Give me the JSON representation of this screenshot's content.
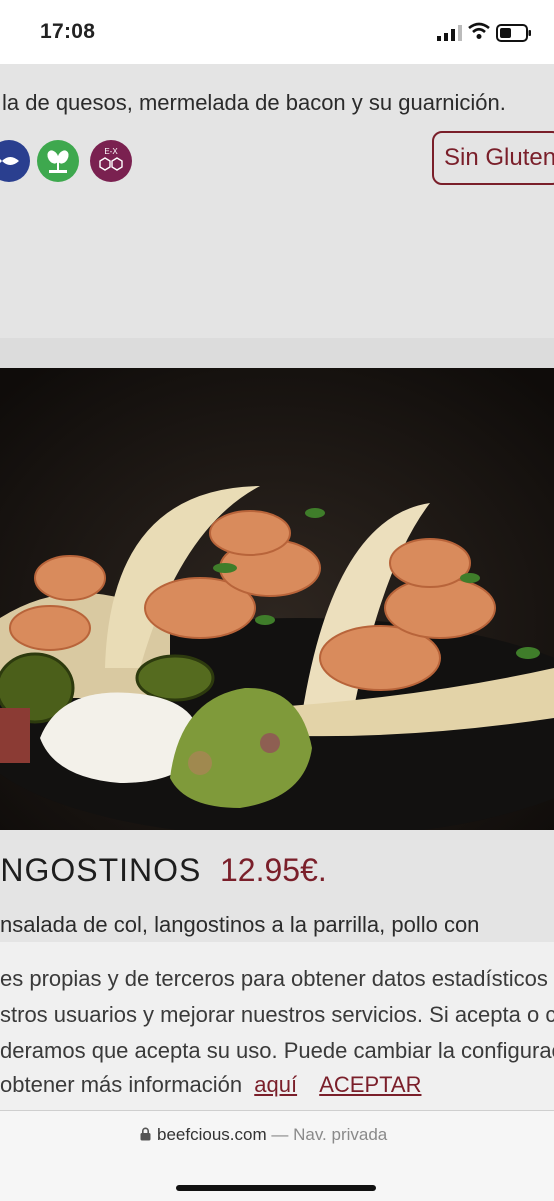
{
  "status": {
    "time": "17:08"
  },
  "card1": {
    "description": "la de quesos, mermelada de bacon y su guarnición.",
    "badge": "Sin Gluten",
    "allergen_icons": [
      "fish-icon",
      "vegetable-icon",
      "ex-allergen-icon"
    ],
    "allergen_ex_label": "E-X"
  },
  "card2": {
    "title": "ANGOSTINOS",
    "price": "12.95€.",
    "description": "nsalada de col, langostinos a la parrilla, pollo con"
  },
  "cookie": {
    "line1": "es propias y de terceros para obtener datos estadísticos d",
    "line2": "stros usuarios y mejorar nuestros servicios. Si acepta o co",
    "line3": "deramos que acepta su uso. Puede cambiar la configurac",
    "line4_prefix": " obtener más información",
    "link_text": "aquí",
    "accept_label": "ACEPTAR"
  },
  "browser": {
    "domain": "beefcious.com",
    "mode": "— Nav. privada"
  },
  "colors": {
    "accent": "#7a1f2a",
    "fish": "#2a3f8f",
    "veg": "#3ea84e",
    "ex": "#7a2150"
  }
}
